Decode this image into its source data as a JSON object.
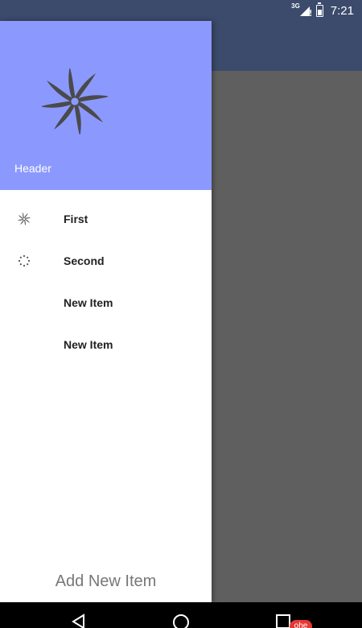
{
  "status_bar": {
    "network": "3G",
    "time": "7:21"
  },
  "drawer": {
    "header": {
      "title": "Header",
      "logo_icon": "pinwheel-logo-icon"
    },
    "menu_items": [
      {
        "label": "First",
        "icon": "pinwheel-icon"
      },
      {
        "label": "Second",
        "icon": "loading-dots-icon"
      },
      {
        "label": "New Item",
        "icon": ""
      },
      {
        "label": "New Item",
        "icon": ""
      }
    ],
    "footer_action": "Add New Item"
  },
  "nav_bar": {
    "buttons": [
      "back-icon",
      "home-icon",
      "recents-icon"
    ],
    "badge_text": "ohe"
  },
  "colors": {
    "drawer_header": "#8b99ff",
    "toolbar": "#3c4a6c",
    "scrim": "#5f5f5f",
    "badge": "#e53935"
  }
}
